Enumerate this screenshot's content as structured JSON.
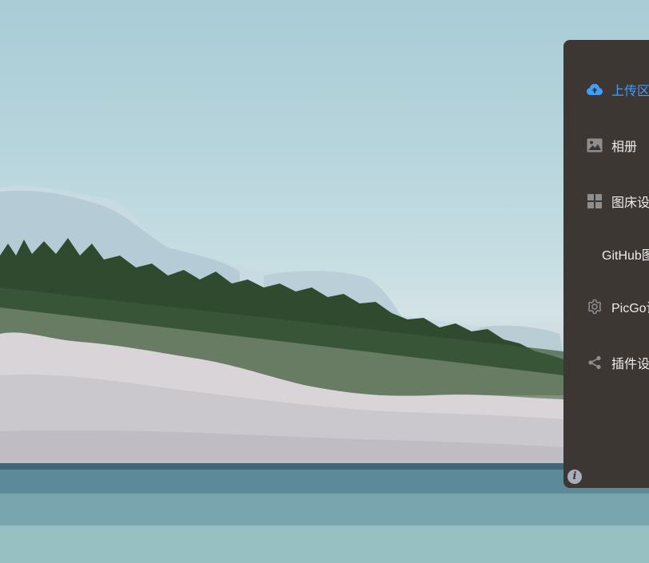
{
  "sidebar": {
    "items": [
      {
        "label": "上传区",
        "icon": "cloud-upload-icon",
        "active": true
      },
      {
        "label": "相册",
        "icon": "image-icon",
        "active": false
      },
      {
        "label": "图床设置",
        "icon": "grid-icon",
        "active": false
      },
      {
        "label": "GitHub图床",
        "icon": "",
        "active": false
      },
      {
        "label": "PicGo设置",
        "icon": "gear-icon",
        "active": false
      },
      {
        "label": "插件设置",
        "icon": "share-icon",
        "active": false
      }
    ],
    "info_label": "i"
  },
  "colors": {
    "panel_bg": "#3d3733",
    "active": "#409eff",
    "text": "#ececec"
  }
}
